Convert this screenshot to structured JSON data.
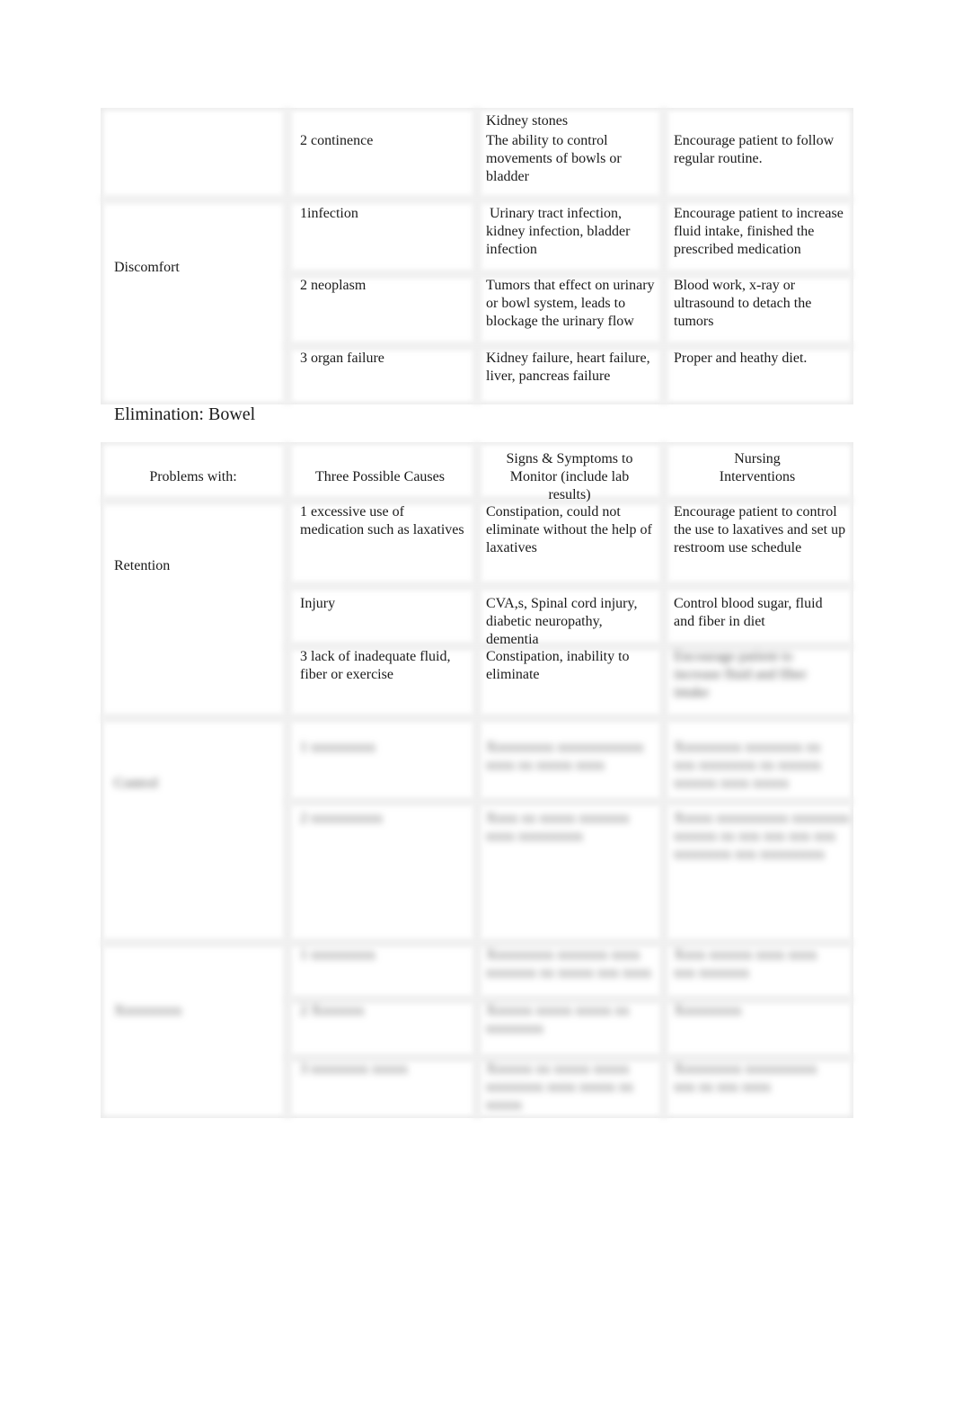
{
  "urinary_table": {
    "rows": [
      {
        "problem": "",
        "cause": "",
        "signs": "Kidney stones",
        "intervention": ""
      },
      {
        "problem": "",
        "cause": "2 continence",
        "signs": "The ability to control movements of bowls or bladder",
        "intervention": "Encourage patient to follow regular routine."
      },
      {
        "problem": "Discomfort",
        "cause": "1infection",
        "signs": " Urinary tract infection, kidney infection, bladder infection",
        "intervention": "Encourage patient to increase fluid intake, finished the prescribed medication"
      },
      {
        "problem": "",
        "cause": "2 neoplasm",
        "signs": "Tumors that effect on urinary or bowl system, leads to blockage the urinary flow",
        "intervention": "Blood work, x-ray or ultrasound to detach the tumors"
      },
      {
        "problem": "",
        "cause": "3 organ failure",
        "signs": "Kidney failure, heart failure, liver, pancreas failure",
        "intervention": "Proper and heathy diet."
      }
    ]
  },
  "section_heading": "Elimination: Bowel",
  "bowel_table": {
    "headers": {
      "problem": "Problems with:",
      "cause": "Three Possible Causes",
      "signs": "Signs & Symptoms to Monitor (include lab results)",
      "intervention": "Nursing Interventions"
    },
    "retention": {
      "problem": "Retention",
      "rows": [
        {
          "cause": "1 excessive use of medication such as laxatives",
          "signs": "Constipation, could not eliminate without the help of laxatives",
          "intervention": "Encourage patient to control the use to laxatives and set up restroom use schedule"
        },
        {
          "cause": "Injury",
          "signs": "CVA,s, Spinal cord injury, diabetic neuropathy, dementia",
          "intervention": "Control blood sugar, fluid and fiber in diet"
        },
        {
          "cause": "3 lack of inadequate fluid, fiber or exercise",
          "signs": "Constipation, inability to eliminate",
          "intervention": "Encourage patient to increase fluid and fiber intake"
        }
      ]
    },
    "blurred_sections": [
      {
        "problem": "Control",
        "rows": [
          {
            "cause": "1 xxxxxxxxx",
            "signs": "Xxxxxxxxx xxxxxxxxxxxx xxxx xx xxxxx xxxx",
            "intervention": "Xxxxxxxxx xxxxxxxx xx xxx xxxxxxxx xx xxxxxx xxxxxx xxxx xxxxx"
          },
          {
            "cause": "2 xxxxxxxxxx",
            "signs": "Xxxx xx xxxxx xxxxxxx xxxx xxxxxxxxx",
            "intervention": "Xxxxx xxxxxxxxxx xxxxxxxx xxxxxx xx xxx xxx xxx xxx xxxxxxxx xxx xxxxxxxxx"
          }
        ]
      },
      {
        "problem": "Xxxxxxxxx",
        "rows": [
          {
            "cause": "1 xxxxxxxxx",
            "signs": "Xxxxxxxxx xxxxxxx xxxx xxxxxxx xx xxxxx xxx xxxx",
            "intervention": "Xxxx xxxxxx xxxx xxxx xxx xxxxxxx"
          },
          {
            "cause": "2 Xxxxxxx",
            "signs": "Xxxxxx xxxxx xxxxx xx xxxxxxxx",
            "intervention": "Xxxxxxxxx"
          },
          {
            "cause": "3 xxxxxxxx xxxxx",
            "signs": "Xxxxxx xx xxxxx xxxxx xxxxxxxx xxxx xxxxx xx xxxxx",
            "intervention": "Xxxxxxxxx xxxxxxxxxx xxx xx xxx xxxx"
          }
        ]
      }
    ]
  }
}
